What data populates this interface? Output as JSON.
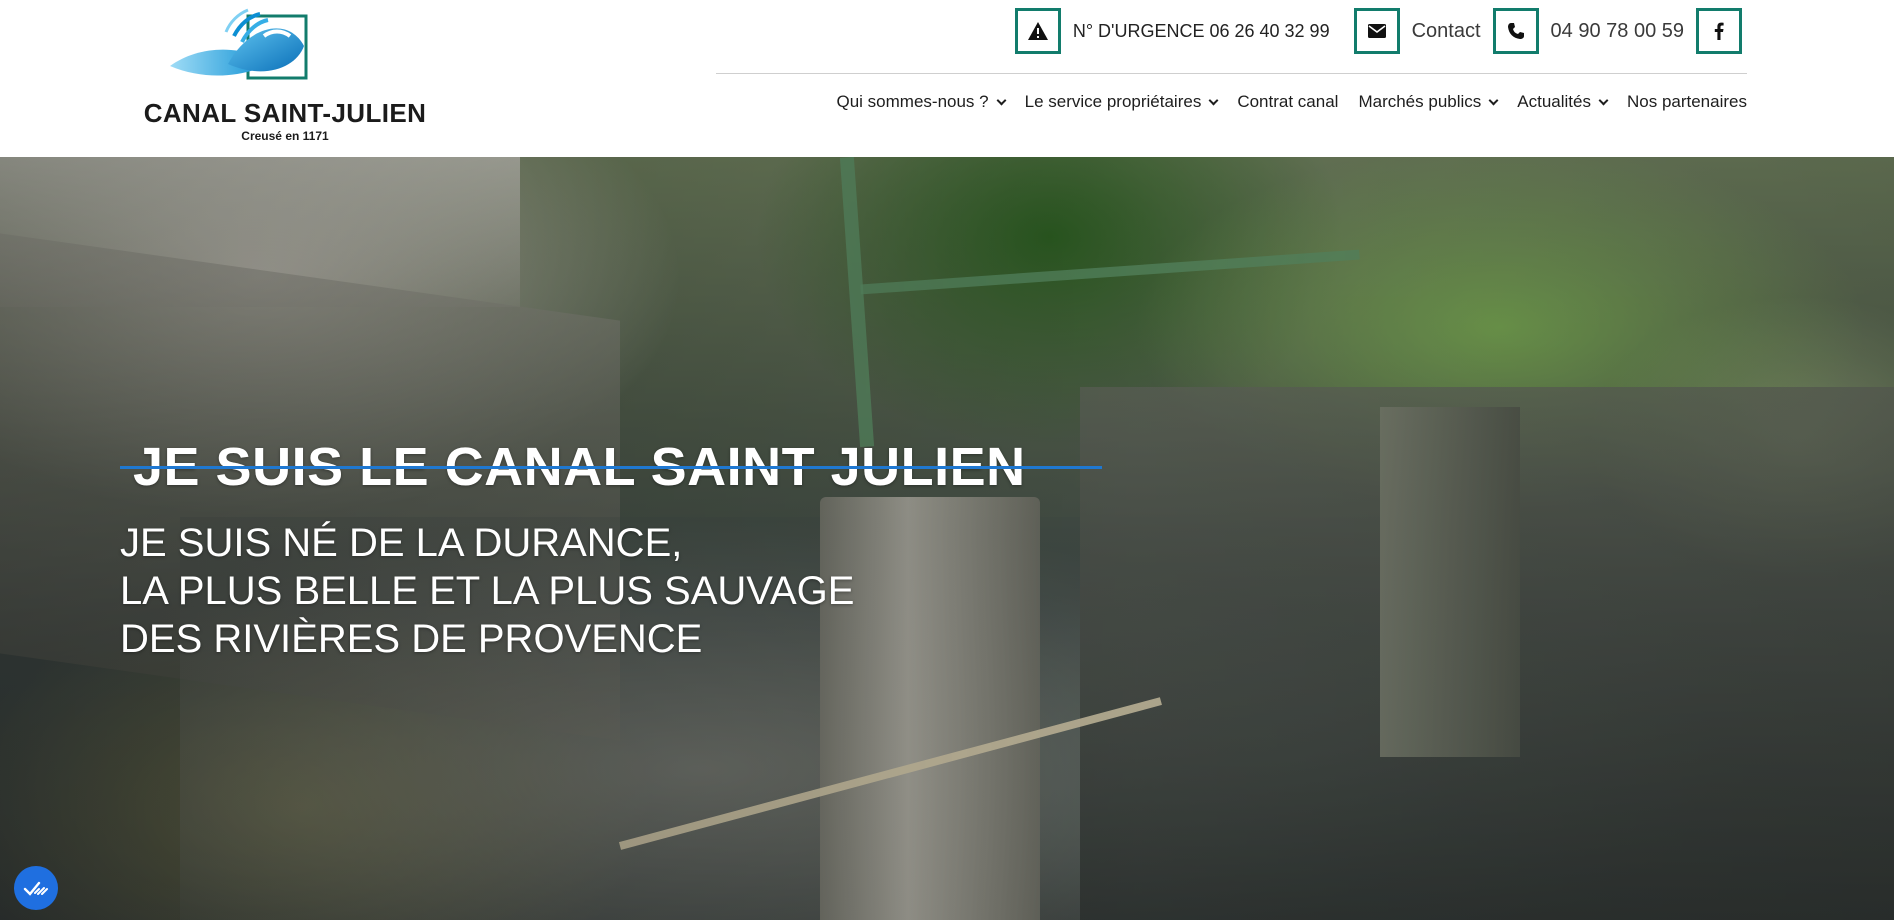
{
  "brand": {
    "name": "CANAL SAINT-JULIEN",
    "tagline": "Creusé en 1171"
  },
  "topbar": {
    "urgence_label": "N° D'URGENCE 06 26 40 32 99",
    "contact_label": "Contact",
    "phone_label": "04 90 78 00 59",
    "icons": [
      "warning-icon",
      "envelope-icon",
      "phone-icon",
      "facebook-icon"
    ],
    "accent": "#127c6c"
  },
  "nav": {
    "items": [
      {
        "label": "Qui sommes-nous ?",
        "dropdown": true
      },
      {
        "label": "Le service propriétaires",
        "dropdown": true
      },
      {
        "label": "Contrat canal",
        "dropdown": false
      },
      {
        "label": "Marchés publics",
        "dropdown": true
      },
      {
        "label": "Actualités",
        "dropdown": true
      },
      {
        "label": "Nos partenaires",
        "dropdown": false
      }
    ]
  },
  "hero": {
    "title": "JE SUIS LE CANAL SAINT JULIEN",
    "subtitle_lines": [
      "JE SUIS NÉ DE LA DURANCE,",
      "LA PLUS BELLE ET LA PLUS SAUVAGE",
      "DES RIVIÈRES DE PROVENCE"
    ],
    "accent": "#1f78d1"
  },
  "floating_badge": {
    "icon": "cookie-consent-icon",
    "color": "#1f6fe0"
  }
}
